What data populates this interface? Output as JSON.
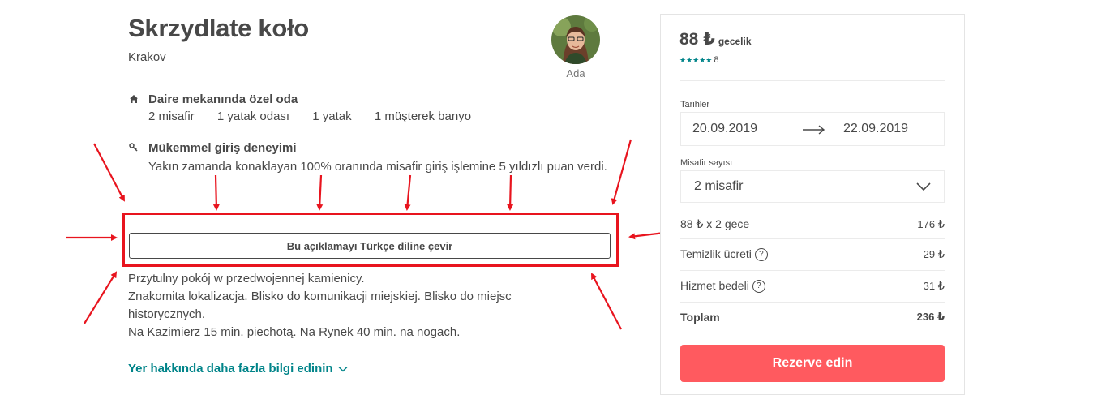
{
  "listing": {
    "title": "Skrzydlate koło",
    "city": "Krakov"
  },
  "host": {
    "name": "Ada",
    "avatar_icon": "host-avatar-photo"
  },
  "features": {
    "room": {
      "icon": "home-icon",
      "title": "Daire mekanında özel oda",
      "details": [
        "2 misafir",
        "1 yatak odası",
        "1 yatak",
        "1 müşterek banyo"
      ]
    },
    "checkin": {
      "icon": "key-icon",
      "title": "Mükemmel giriş deneyimi",
      "text": "Yakın zamanda konaklayan 100% oranında misafir giriş işlemine 5 yıldızlı puan verdi."
    }
  },
  "translate_button": "Bu açıklamayı Türkçe diline çevir",
  "description": [
    "Przytulny pokój w przedwojennej kamienicy.",
    "Znakomita lokalizacja. Blisko do komunikacji miejskiej. Blisko do miejsc historycznych.",
    "Na Kazimierz 15 min. piechotą. Na Rynek 40 min. na nogach."
  ],
  "more_link": "Yer hakkında daha fazla bilgi edinin",
  "booking": {
    "price": "88 ₺",
    "per_night": "gecelik",
    "stars": "★★★★★",
    "review_count": "8",
    "dates_label": "Tarihler",
    "check_in": "20.09.2019",
    "check_out": "22.09.2019",
    "guests_label": "Misafir sayısı",
    "guests_value": "2 misafir",
    "lines": [
      {
        "label": "88 ₺ x 2 gece",
        "amount": "176 ₺",
        "help": false
      },
      {
        "label": "Temizlik ücreti",
        "amount": "29 ₺",
        "help": true
      },
      {
        "label": "Hizmet bedeli",
        "amount": "31 ₺",
        "help": true
      }
    ],
    "total_label": "Toplam",
    "total_amount": "236 ₺",
    "reserve_button": "Rezerve edin"
  },
  "colors": {
    "accent_teal": "#008489",
    "reserve_red": "#ff5a5f",
    "annotation_red": "#e8141e",
    "text": "#484848"
  }
}
